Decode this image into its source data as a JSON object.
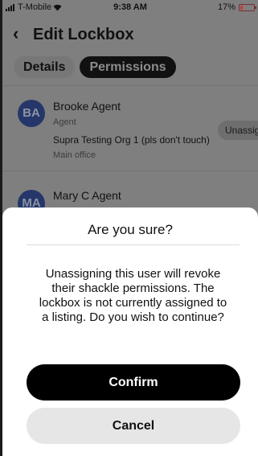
{
  "status_bar": {
    "carrier": "T-Mobile",
    "time": "9:38 AM",
    "battery": "17%",
    "battery_level": 0.17
  },
  "header": {
    "back_icon": "chevron-left-icon",
    "title": "Edit Lockbox"
  },
  "tabs": [
    {
      "label": "Details",
      "selected": false
    },
    {
      "label": "Permissions",
      "selected": true
    }
  ],
  "agents": [
    {
      "initials": "BA",
      "name": "Brooke Agent",
      "role": "Agent",
      "org": "Supra Testing Org 1 (pls don't touch)",
      "office": "Main office",
      "action_label": "Unassign"
    },
    {
      "initials": "MA",
      "name": "Mary C Agent"
    }
  ],
  "modal": {
    "title": "Are you sure?",
    "message": "Unassigning this user will revoke their shackle permissions. The lockbox is not currently assigned to a listing. Do you wish to continue?",
    "confirm_label": "Confirm",
    "cancel_label": "Cancel"
  },
  "colors": {
    "overlay": "#7f7f7f",
    "avatar": "#25376a",
    "confirm": "#000000",
    "cancel": "#e6e6e6",
    "battery_low": "#c43a3a"
  }
}
